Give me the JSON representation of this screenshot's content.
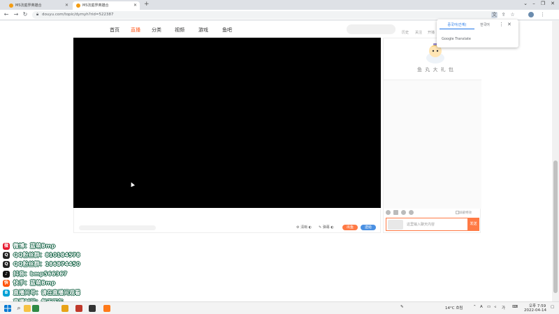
{
  "browser": {
    "tabs": [
      {
        "title": "MS法庭界英雄合"
      },
      {
        "title": "MS法庭界英雄合"
      }
    ],
    "new_tab": "+",
    "url": "douyu.com/topic/dymyh?rid=522387",
    "window_controls": {
      "minimize": "–",
      "maximize": "❐",
      "close": "✕"
    }
  },
  "site": {
    "nav": [
      "首页",
      "直播",
      "分类",
      "视频",
      "游戏",
      "鱼吧"
    ],
    "header_links": [
      "历史",
      "关注",
      "开播"
    ],
    "player_controls": {
      "quality": "清晰",
      "danmu": "弹幕"
    },
    "cast_button": "出鱼",
    "gift_button": "送给",
    "mascot_caption": "鱼 丸 大 礼 包",
    "danmu_toggle": "屏蔽特效",
    "chat_placeholder": "这里输入聊天内容",
    "send_button": "发送"
  },
  "translate_popup": {
    "tab_active": "중국어(간체)",
    "tab_inactive": "한국어",
    "more": "⋮",
    "close": "✕",
    "brand": "Google Translate"
  },
  "overlay": {
    "lines": [
      {
        "icon": "weibo-icon",
        "icon_color": "#e6162d",
        "icon_glyph": "微",
        "text": "微博：蓝萌Bmp"
      },
      {
        "icon": "qq-icon",
        "icon_color": "#222222",
        "icon_glyph": "Q",
        "text": "QQ粉丝群：810184578"
      },
      {
        "icon": "qq-icon",
        "icon_color": "#222222",
        "icon_glyph": "Q",
        "text": "QQ粉丝群：186874450"
      },
      {
        "icon": "douyin-icon",
        "icon_color": "#111111",
        "icon_glyph": "♪",
        "text": "抖音：bmp566367"
      },
      {
        "icon": "kuaishou-icon",
        "icon_color": "#ff5000",
        "icon_glyph": "快",
        "text": "快手：蓝萌Bmp"
      },
      {
        "icon": "bilibili-icon",
        "icon_color": "#00a1d6",
        "icon_glyph": "B",
        "text": "直播间号：请在直播间观看"
      },
      {
        "icon": "",
        "icon_color": "",
        "icon_glyph": "",
        "text": "直播时间：每天下午"
      }
    ]
  },
  "taskbar": {
    "search_glyph": "⌕",
    "weather": "14°C 흐림",
    "lang": "A",
    "ime": "가",
    "time": "오후 7:59",
    "date": "2022-04-14",
    "apps": [
      {
        "name": "file-explorer-icon",
        "color": "#f6c244"
      },
      {
        "name": "chrome-icon",
        "color": "#2f8a45"
      },
      {
        "name": "folder-icon",
        "color": "#e8a317"
      },
      {
        "name": "app-g-icon",
        "color": "#c0392b"
      },
      {
        "name": "obs-icon",
        "color": "#333333"
      },
      {
        "name": "app-orange-icon",
        "color": "#ff7a1a"
      }
    ]
  }
}
